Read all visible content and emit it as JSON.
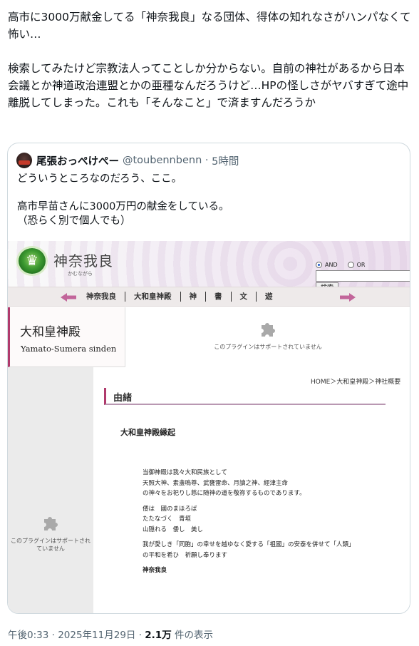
{
  "tweet": {
    "text": "高市に3000万献金してる「神奈我良」なる団体、得体の知れなさがハンパなくて怖い…\n\n検索してみたけど宗教法人ってことしか分からない。自前の神社があるから日本会議とか神道政治連盟とかの亜種なんだろうけど…HPの怪しさがヤバすぎて途中離脱してしまった。これも「そんなこと」で済ますんだろうか"
  },
  "quote": {
    "author_name": "尾張おっぺけぺー",
    "author_handle": "@toubennbenn",
    "time": "5時間",
    "text": "どういうところなのだろう、ここ。\n\n高市早苗さんに3000万円の献金をしている。\n（恐らく別で個人でも）"
  },
  "site": {
    "logo_title": "神奈我良",
    "logo_sub": "かむながら",
    "search": {
      "and_label": "AND",
      "or_label": "OR",
      "button_label": "検索",
      "input_value": ""
    },
    "nav": [
      "神奈我良",
      "大和皇神殿",
      "神",
      "書",
      "文",
      "遊"
    ],
    "banner_title": "大和皇神殿",
    "banner_subtitle": "Yamato-Sumera sinden",
    "plugin_message": "このプラグインはサポートされていません",
    "breadcrumb": "HOME＞大和皇神殿＞神社概要",
    "section_title": "由緒",
    "content": {
      "heading": "大和皇神殿縁起",
      "paragraphs": [
        "当御神殿は我々大和民族として\n天照大神、素盞嗚尊、武甕雷命、月讀之神、經津主命\nの神々をお祀りし慈に随神の道を敬祢するものであります。",
        "倭は　國のまほろば\nたたなづく　青垣\n山隠れる　倭し　美し",
        "我が愛しき「同胞」の幸せを越ゆなく愛する「祖國」の安泰を併せて「人類」\nの平和を希ひ　祈願し奉ります"
      ],
      "signature": "神奈我良"
    }
  },
  "footer": {
    "timestamp": "午後0:33 · 2025年11月29日 · ",
    "views_count": "2.1万",
    "views_label": " 件の表示"
  },
  "colors": {
    "accent": "#b03a6c",
    "muted_text": "#536471",
    "border": "#cfd9de",
    "nav_arrow": "#c2659a"
  }
}
